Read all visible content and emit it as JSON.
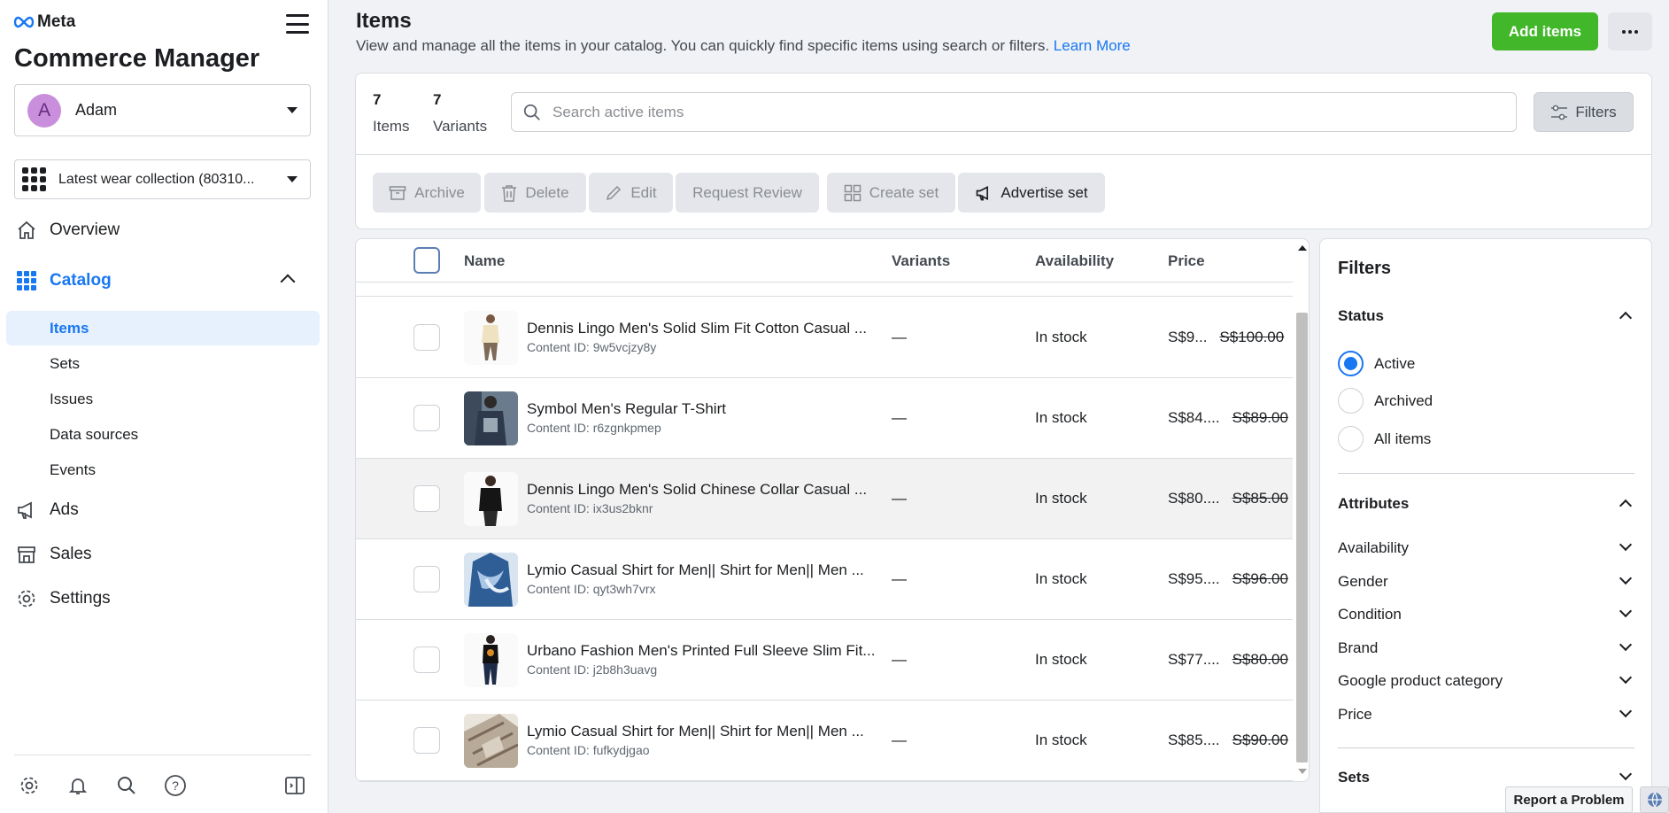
{
  "sidebar": {
    "brand": "Meta",
    "app_title": "Commerce Manager",
    "account": {
      "initial": "A",
      "name": "Adam"
    },
    "catalog_selector": "Latest wear collection (80310...",
    "nav": {
      "overview": "Overview",
      "catalog": "Catalog",
      "ads": "Ads",
      "sales": "Sales",
      "settings": "Settings"
    },
    "catalog_sub": [
      "Items",
      "Sets",
      "Issues",
      "Data sources",
      "Events"
    ]
  },
  "header": {
    "title": "Items",
    "description": "View and manage all the items in your catalog. You can quickly find specific items using search or filters.",
    "learn_more": "Learn More",
    "add_items": "Add items"
  },
  "summary": {
    "items_count": "7",
    "items_label": "Items",
    "variants_count": "7",
    "variants_label": "Variants"
  },
  "search": {
    "placeholder": "Search active items"
  },
  "filters_button": "Filters",
  "actions": {
    "archive": "Archive",
    "delete": "Delete",
    "edit": "Edit",
    "request_review": "Request Review",
    "create_set": "Create set",
    "advertise_set": "Advertise set"
  },
  "table": {
    "columns": {
      "name": "Name",
      "variants": "Variants",
      "availability": "Availability",
      "price": "Price"
    },
    "rows": [
      {
        "name": "Dennis Lingo Men's Solid Slim Fit Cotton Casual ...",
        "content_id": "Content ID: 9w5vcjzy8y",
        "variants": "—",
        "availability": "In stock",
        "price": "S$9...",
        "old_price": "S$100.00"
      },
      {
        "name": "Symbol Men's Regular T-Shirt",
        "content_id": "Content ID: r6zgnkpmep",
        "variants": "—",
        "availability": "In stock",
        "price": "S$84....",
        "old_price": "S$89.00"
      },
      {
        "name": "Dennis Lingo Men's Solid Chinese Collar Casual ...",
        "content_id": "Content ID: ix3us2bknr",
        "variants": "—",
        "availability": "In stock",
        "price": "S$80....",
        "old_price": "S$85.00"
      },
      {
        "name": "Lymio Casual Shirt for Men|| Shirt for Men|| Men ...",
        "content_id": "Content ID: qyt3wh7vrx",
        "variants": "—",
        "availability": "In stock",
        "price": "S$95....",
        "old_price": "S$96.00"
      },
      {
        "name": "Urbano Fashion Men's Printed Full Sleeve Slim Fit...",
        "content_id": "Content ID: j2b8h3uavg",
        "variants": "—",
        "availability": "In stock",
        "price": "S$77....",
        "old_price": "S$80.00"
      },
      {
        "name": "Lymio Casual Shirt for Men|| Shirt for Men|| Men ...",
        "content_id": "Content ID: fufkydjgao",
        "variants": "—",
        "availability": "In stock",
        "price": "S$85....",
        "old_price": "S$90.00"
      }
    ]
  },
  "filter_panel": {
    "title": "Filters",
    "status_title": "Status",
    "status_options": [
      "Active",
      "Archived",
      "All items"
    ],
    "status_selected": "Active",
    "attributes_title": "Attributes",
    "attributes": [
      "Availability",
      "Gender",
      "Condition",
      "Brand",
      "Google product category",
      "Price"
    ],
    "sets_title": "Sets"
  },
  "footer": {
    "report": "Report a Problem"
  },
  "colors": {
    "accent": "#1877f2",
    "add_button": "#42b72a"
  }
}
